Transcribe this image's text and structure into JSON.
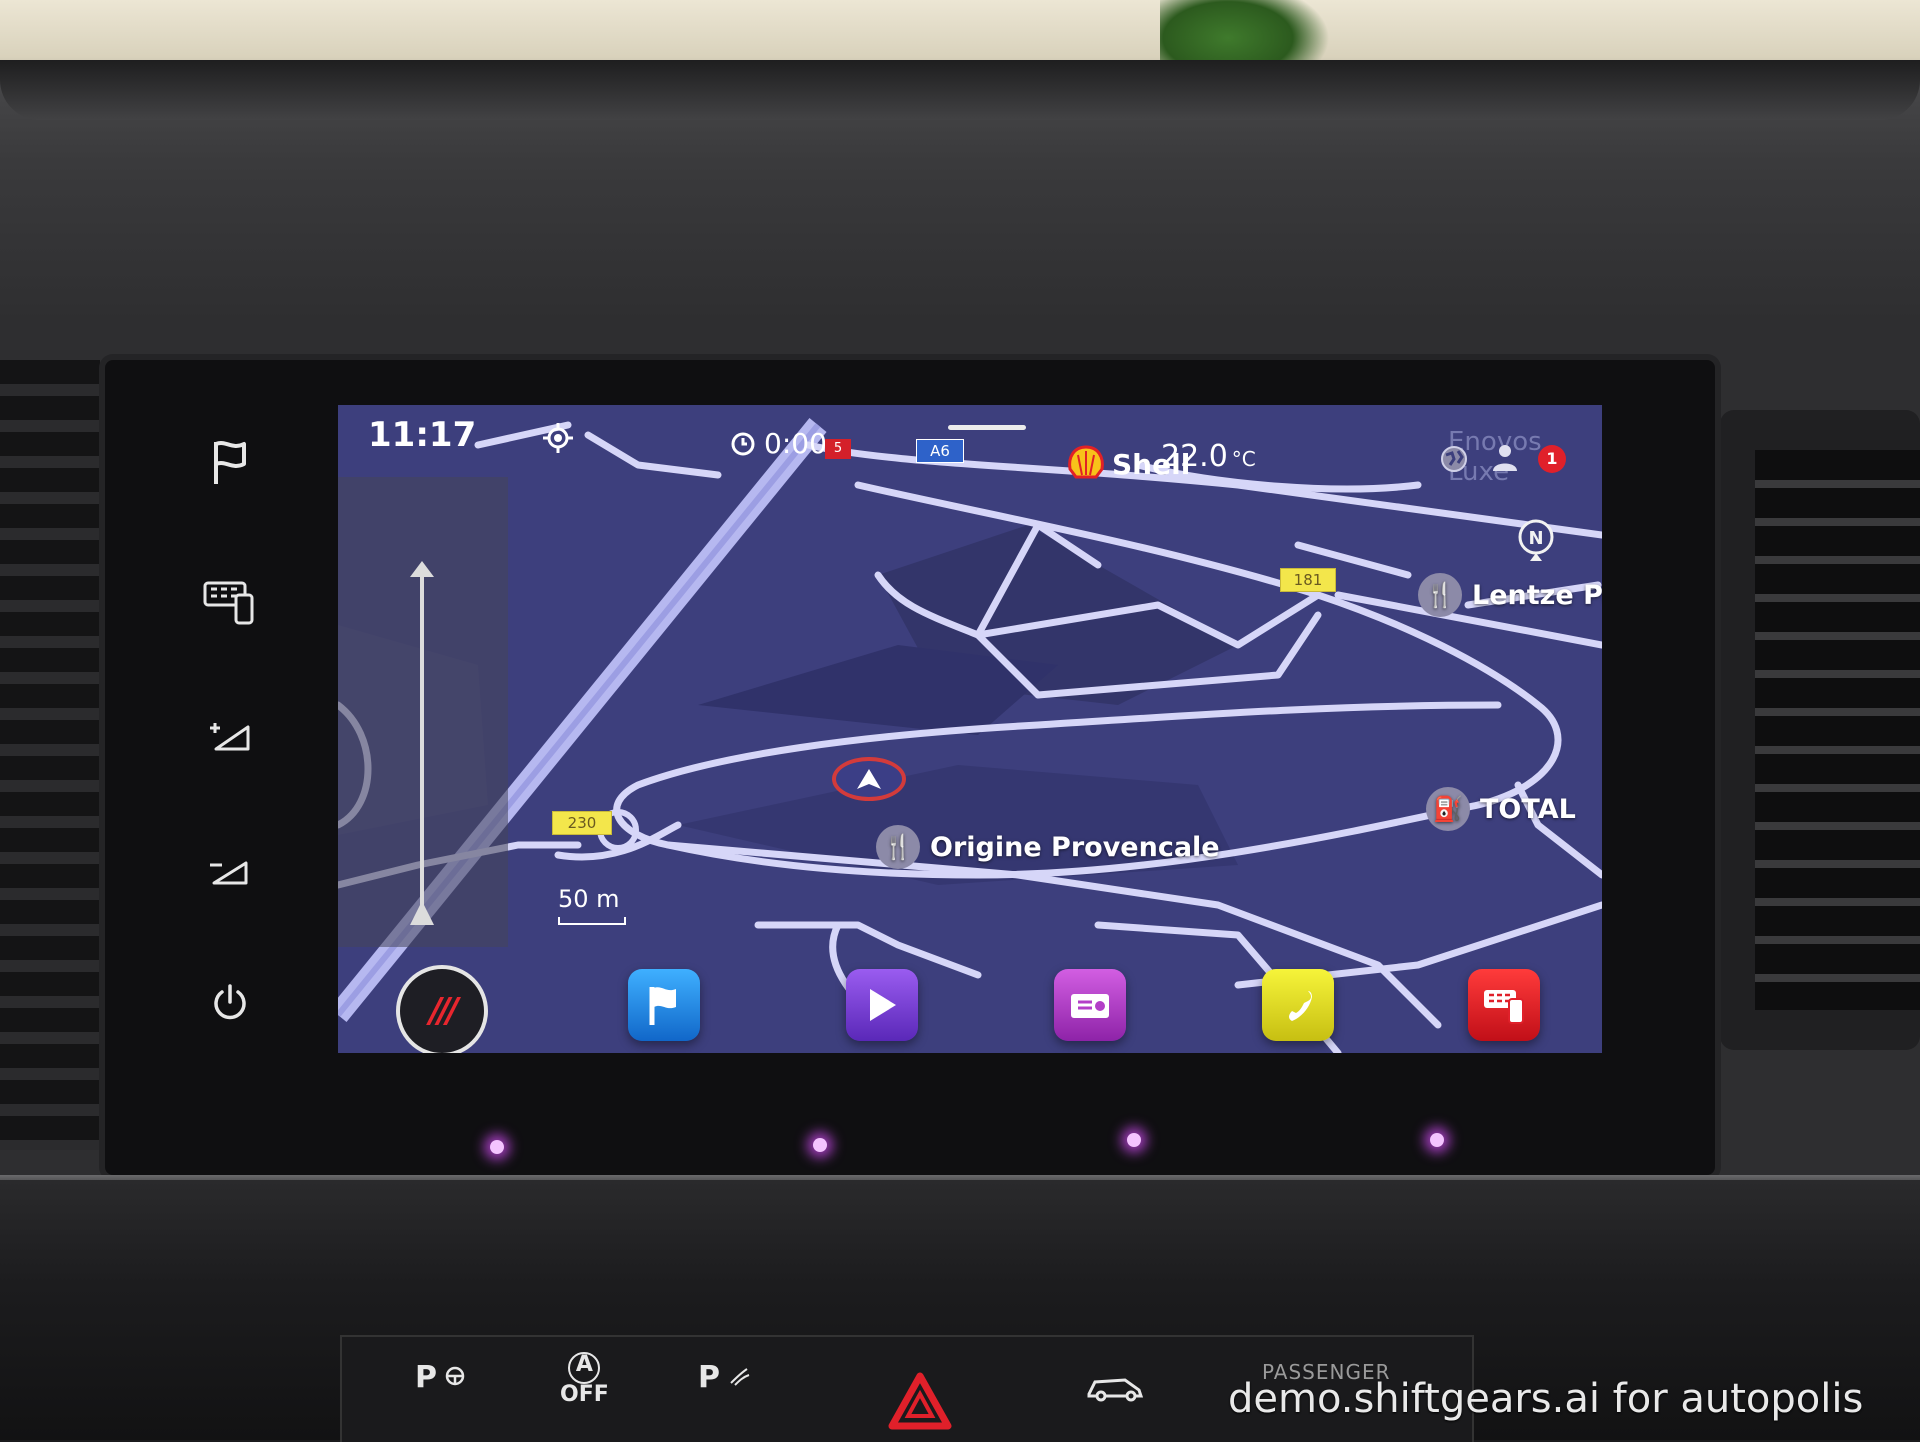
{
  "status_bar": {
    "time": "11:17",
    "route_timer": "0:00",
    "timer_tag": "5",
    "motorway_shield": "A6",
    "fuel_brand": "Shell",
    "temperature": "22.0",
    "temperature_unit": "°C",
    "ghost_label": "Enovos Luxe",
    "notification_count": "1"
  },
  "map": {
    "compass_label": "N",
    "road_numbers": [
      "181",
      "230"
    ],
    "poi": {
      "lentze": "Lentze Pa",
      "total": "TOTAL",
      "origine": "Origine Provencale"
    },
    "scale_label": "50 m",
    "route_color": "#d9d9f5",
    "land_color": "#3d3f7d"
  },
  "dock": {
    "apps": [
      {
        "name": "navigation",
        "color": "#1d8ee6",
        "icon": "flag-icon"
      },
      {
        "name": "media",
        "color": "#7a3fd8",
        "icon": "play-icon"
      },
      {
        "name": "radio",
        "color": "#b33ec8",
        "icon": "radio-icon"
      },
      {
        "name": "phone",
        "color": "#e6e12a",
        "icon": "phone-icon"
      },
      {
        "name": "vehicle-settings",
        "color": "#e0202a",
        "icon": "car-settings-icon"
      }
    ],
    "home_glyph": "///"
  },
  "hard_keys": [
    "flag-icon",
    "car-settings-icon",
    "volume-up-icon",
    "volume-down-icon",
    "power-icon"
  ],
  "console": {
    "park_assist": "P",
    "auto_hold_top": "A",
    "auto_hold_bottom": "OFF",
    "parking_sensor": "P",
    "passenger_airbag": "PASSENGER"
  },
  "watermark": "demo.shiftgears.ai for autopolis"
}
